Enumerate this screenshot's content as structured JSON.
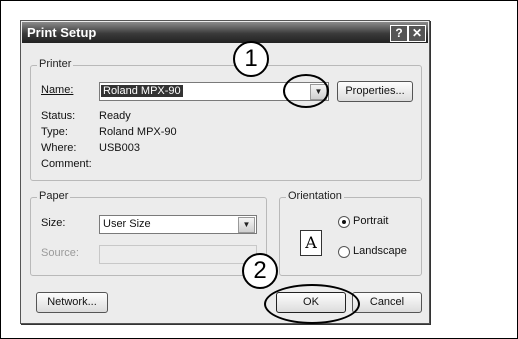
{
  "window": {
    "title": "Print Setup",
    "help_label": "?",
    "close_label": "✕"
  },
  "printer": {
    "group_label": "Printer",
    "name_label": "Name:",
    "name_value": "Roland MPX-90",
    "properties_button": "Properties...",
    "status_label": "Status:",
    "status_value": "Ready",
    "type_label": "Type:",
    "type_value": "Roland MPX-90",
    "where_label": "Where:",
    "where_value": "USB003",
    "comment_label": "Comment:",
    "comment_value": ""
  },
  "paper": {
    "group_label": "Paper",
    "size_label": "Size:",
    "size_value": "User Size",
    "source_label": "Source:",
    "source_value": ""
  },
  "orientation": {
    "group_label": "Orientation",
    "icon_letter": "A",
    "portrait_label": "Portrait",
    "landscape_label": "Landscape",
    "selected": "Portrait"
  },
  "buttons": {
    "network": "Network...",
    "ok": "OK",
    "cancel": "Cancel"
  },
  "callouts": {
    "one": "1",
    "two": "2"
  },
  "icons": {
    "dropdown": "chevron-down-icon",
    "help": "help-icon",
    "close": "close-icon"
  }
}
